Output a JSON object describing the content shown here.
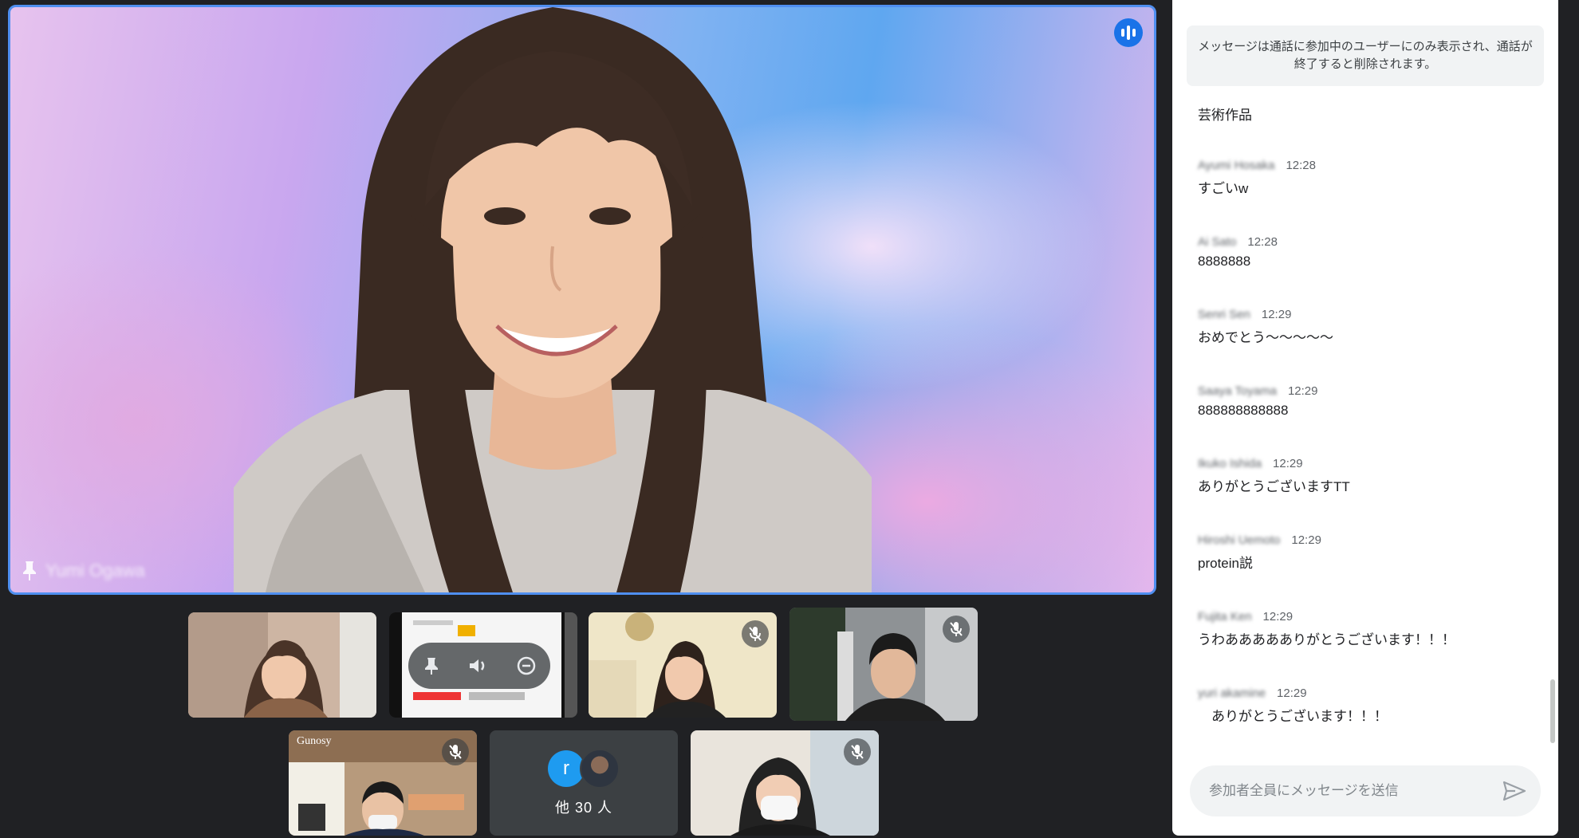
{
  "main_speaker": {
    "name": "Yumi Ogawa",
    "speaking_indicator": "audio-wave-icon",
    "pin_icon": "pin-icon"
  },
  "tiles": [
    {
      "name": "",
      "muted": false
    },
    {
      "name": "",
      "muted": false,
      "is_screen_share": true
    },
    {
      "name": "",
      "muted": true
    },
    {
      "name": "",
      "muted": true
    },
    {
      "name": "Gunosy",
      "muted": true
    },
    {
      "name": "",
      "muted": true
    }
  ],
  "others": {
    "avatar_letter": "r",
    "label": "他 30 人"
  },
  "chat": {
    "notice": "メッセージは通話に参加中のユーザーにのみ表示され、通話が終了すると削除されます。",
    "first_message": "芸術作品",
    "messages": [
      {
        "sender": "Ayumi Hosaka",
        "time": "12:28",
        "text": "すごいw"
      },
      {
        "sender": "Ai Sato",
        "time": "12:28",
        "text": "8888888"
      },
      {
        "sender": "Senri Sen",
        "time": "12:29",
        "text": "おめでとう〜〜〜〜〜"
      },
      {
        "sender": "Saaya Toyama",
        "time": "12:29",
        "text": "888888888888"
      },
      {
        "sender": "Ikuko Ishida",
        "time": "12:29",
        "text": "ありがとうございますTT"
      },
      {
        "sender": "Hiroshi Uemoto",
        "time": "12:29",
        "text": "protein説"
      },
      {
        "sender": "Fujita Ken",
        "time": "12:29",
        "text": "うわああああありがとうございます！！！"
      },
      {
        "sender": "yuri akamine",
        "time": "12:29",
        "text": "　ありがとうございます！！！"
      }
    ],
    "input_placeholder": "参加者全員にメッセージを送信",
    "send_icon": "send-icon"
  },
  "colors": {
    "background": "#202124",
    "active_speaker_border": "#4f8ff0",
    "accent": "#1a73e8",
    "panel": "#ffffff"
  }
}
